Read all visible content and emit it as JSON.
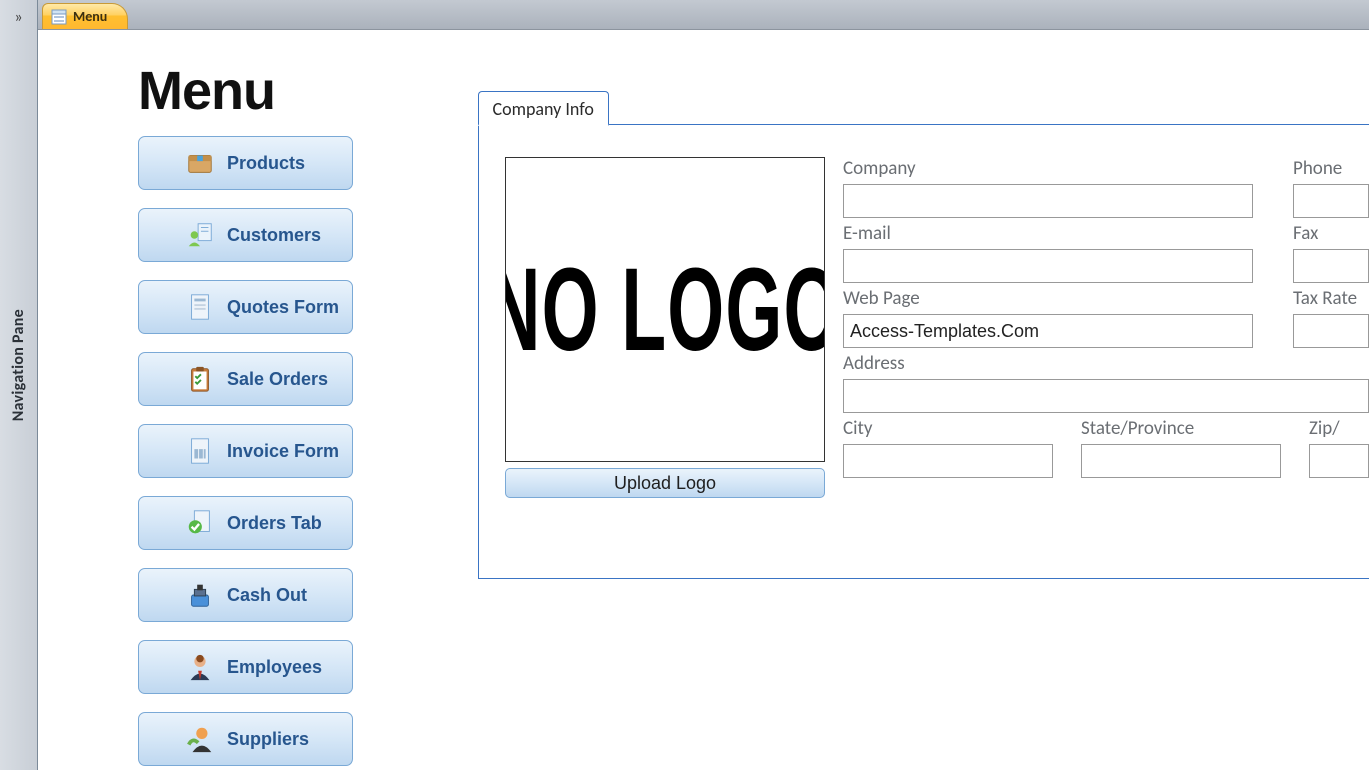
{
  "navPane": {
    "label": "Navigation Pane"
  },
  "tab": {
    "title": "Menu"
  },
  "page": {
    "heading": "Menu"
  },
  "menu": {
    "items": [
      {
        "label": "Products"
      },
      {
        "label": "Customers"
      },
      {
        "label": "Quotes Form"
      },
      {
        "label": "Sale Orders"
      },
      {
        "label": "Invoice Form"
      },
      {
        "label": "Orders Tab"
      },
      {
        "label": "Cash Out"
      },
      {
        "label": "Employees"
      },
      {
        "label": "Suppliers"
      }
    ]
  },
  "companyInfo": {
    "tabLabel": "Company Info",
    "logoPlaceholder": "NO LOGO",
    "uploadLabel": "Upload Logo",
    "fields": {
      "company": {
        "label": "Company",
        "value": ""
      },
      "phone": {
        "label": "Phone",
        "value": ""
      },
      "email": {
        "label": "E-mail",
        "value": ""
      },
      "fax": {
        "label": "Fax",
        "value": ""
      },
      "webpage": {
        "label": "Web Page",
        "value": "Access-Templates.Com"
      },
      "taxrate": {
        "label": "Tax Rate",
        "value": ""
      },
      "address": {
        "label": "Address",
        "value": ""
      },
      "city": {
        "label": "City",
        "value": ""
      },
      "state": {
        "label": "State/Province",
        "value": ""
      },
      "zip": {
        "label": "Zip/",
        "value": ""
      }
    }
  }
}
